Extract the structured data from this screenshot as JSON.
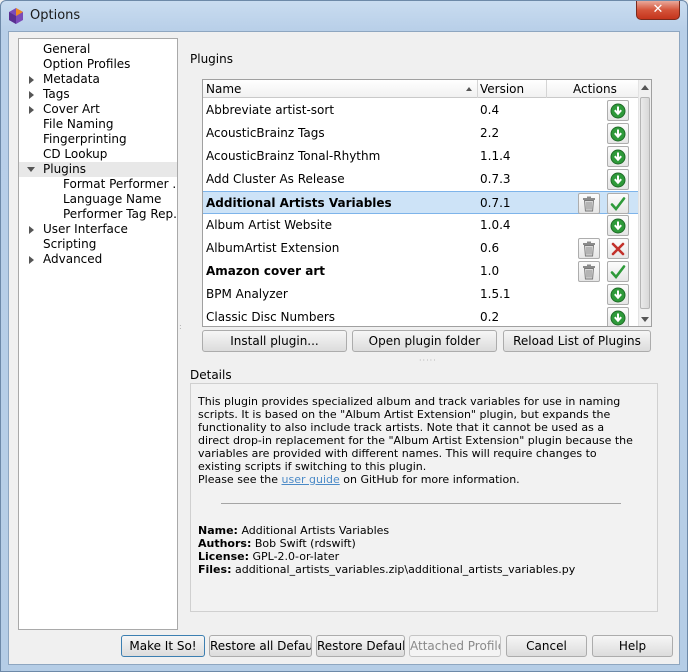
{
  "window": {
    "title": "Options",
    "close_label": "✕"
  },
  "tree": [
    {
      "label": "General",
      "indent": 0,
      "expander": "none",
      "selected": false
    },
    {
      "label": "Option Profiles",
      "indent": 0,
      "expander": "none",
      "selected": false
    },
    {
      "label": "Metadata",
      "indent": 0,
      "expander": "collapsed",
      "selected": false
    },
    {
      "label": "Tags",
      "indent": 0,
      "expander": "collapsed",
      "selected": false
    },
    {
      "label": "Cover Art",
      "indent": 0,
      "expander": "collapsed",
      "selected": false
    },
    {
      "label": "File Naming",
      "indent": 0,
      "expander": "none",
      "selected": false
    },
    {
      "label": "Fingerprinting",
      "indent": 0,
      "expander": "none",
      "selected": false
    },
    {
      "label": "CD Lookup",
      "indent": 0,
      "expander": "none",
      "selected": false
    },
    {
      "label": "Plugins",
      "indent": 0,
      "expander": "expanded",
      "selected": true
    },
    {
      "label": "Format Performer ...",
      "indent": 1,
      "expander": "none",
      "selected": false
    },
    {
      "label": "Language Name",
      "indent": 1,
      "expander": "none",
      "selected": false
    },
    {
      "label": "Performer Tag Rep...",
      "indent": 1,
      "expander": "none",
      "selected": false
    },
    {
      "label": "User Interface",
      "indent": 0,
      "expander": "collapsed",
      "selected": false
    },
    {
      "label": "Scripting",
      "indent": 0,
      "expander": "none",
      "selected": false
    },
    {
      "label": "Advanced",
      "indent": 0,
      "expander": "collapsed",
      "selected": false
    }
  ],
  "plugins_section": {
    "label": "Plugins",
    "columns": {
      "name": "Name",
      "version": "Version",
      "actions": "Actions"
    },
    "rows": [
      {
        "name": "Abbreviate artist-sort",
        "version": "0.4",
        "bold": false,
        "selected": false,
        "trash": false,
        "action": "install"
      },
      {
        "name": "AcousticBrainz Tags",
        "version": "2.2",
        "bold": false,
        "selected": false,
        "trash": false,
        "action": "install"
      },
      {
        "name": "AcousticBrainz Tonal-Rhythm",
        "version": "1.1.4",
        "bold": false,
        "selected": false,
        "trash": false,
        "action": "install"
      },
      {
        "name": "Add Cluster As Release",
        "version": "0.7.3",
        "bold": false,
        "selected": false,
        "trash": false,
        "action": "install"
      },
      {
        "name": "Additional Artists Variables",
        "version": "0.7.1",
        "bold": true,
        "selected": true,
        "trash": true,
        "action": "enabled"
      },
      {
        "name": "Album Artist Website",
        "version": "1.0.4",
        "bold": false,
        "selected": false,
        "trash": false,
        "action": "install"
      },
      {
        "name": "AlbumArtist Extension",
        "version": "0.6",
        "bold": false,
        "selected": false,
        "trash": true,
        "action": "disabled"
      },
      {
        "name": "Amazon cover art",
        "version": "1.0",
        "bold": true,
        "selected": false,
        "trash": true,
        "action": "enabled"
      },
      {
        "name": "BPM Analyzer",
        "version": "1.5.1",
        "bold": false,
        "selected": false,
        "trash": false,
        "action": "install"
      },
      {
        "name": "Classic Disc Numbers",
        "version": "0.2",
        "bold": false,
        "selected": false,
        "trash": false,
        "action": "install"
      }
    ],
    "buttons": {
      "install": "Install plugin...",
      "open_folder": "Open plugin folder",
      "reload": "Reload List of Plugins"
    }
  },
  "details": {
    "label": "Details",
    "description": "This plugin provides specialized album and track variables for use in naming scripts. It is based on the \"Album Artist Extension\" plugin, but expands the functionality to also include track artists. Note that it cannot be used as a direct drop-in replacement for the \"Album Artist Extension\" plugin because the variables are provided with different names. This will require changes to existing scripts if switching to this plugin.",
    "see_prefix": "Please see the ",
    "see_link": "user guide",
    "see_suffix": " on GitHub for more information.",
    "name_label": "Name:",
    "name_value": " Additional Artists Variables",
    "authors_label": "Authors:",
    "authors_value": " Bob Swift (rdswift)",
    "license_label": "License:",
    "license_value": " GPL-2.0-or-later",
    "files_label": "Files:",
    "files_value": " additional_artists_variables.zip\\additional_artists_variables.py"
  },
  "footer": {
    "make_it_so": "Make It So!",
    "restore_all": "Restore all Defaults",
    "restore": "Restore Defaults",
    "attached_profiles": "Attached Profiles",
    "cancel": "Cancel",
    "help": "Help"
  },
  "colors": {
    "install": "#2e9a3a",
    "enabled": "#2e9a3a",
    "disabled": "#c2302a",
    "selection": "#cde3f7"
  }
}
